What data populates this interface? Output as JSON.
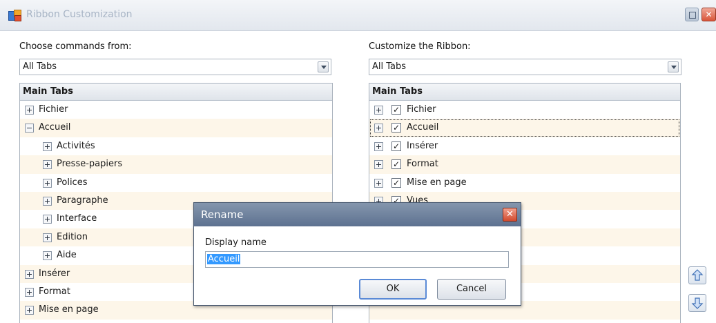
{
  "window": {
    "title": "Ribbon Customization",
    "maximize_glyph": "",
    "close_glyph": "✕"
  },
  "left": {
    "label": "Choose commands from:",
    "combo_value": "All Tabs",
    "header": "Main Tabs",
    "items": [
      {
        "label": "Fichier",
        "expander": "plus"
      },
      {
        "label": "Accueil",
        "expander": "minus"
      },
      {
        "label": "Activités",
        "expander": "plus"
      },
      {
        "label": "Presse-papiers",
        "expander": "plus"
      },
      {
        "label": "Polices",
        "expander": "plus"
      },
      {
        "label": "Paragraphe",
        "expander": "plus"
      },
      {
        "label": "Interface",
        "expander": "plus"
      },
      {
        "label": "Edition",
        "expander": "plus"
      },
      {
        "label": "Aide",
        "expander": "plus"
      },
      {
        "label": "Insérer",
        "expander": "plus"
      },
      {
        "label": "Format",
        "expander": "plus"
      },
      {
        "label": "Mise en page",
        "expander": "plus"
      }
    ]
  },
  "right": {
    "label": "Customize the Ribbon:",
    "combo_value": "All Tabs",
    "header": "Main Tabs",
    "items": [
      {
        "label": "Fichier",
        "checked": true
      },
      {
        "label": "Accueil",
        "checked": true
      },
      {
        "label": "Insérer",
        "checked": true
      },
      {
        "label": "Format",
        "checked": true
      },
      {
        "label": "Mise en page",
        "checked": true
      },
      {
        "label": "Vues",
        "checked": true
      }
    ]
  },
  "move_up_icon": "arrow-up-icon",
  "move_down_icon": "arrow-down-icon",
  "dialog": {
    "title": "Rename",
    "close_glyph": "✕",
    "field_label": "Display name",
    "field_value": "Accueil",
    "ok_label": "OK",
    "cancel_label": "Cancel"
  },
  "colors": {
    "selection": "#3399ff",
    "alt_row": "#fdf6e9",
    "dialog_title": "#6b7e99",
    "close_red": "#d9553a"
  }
}
